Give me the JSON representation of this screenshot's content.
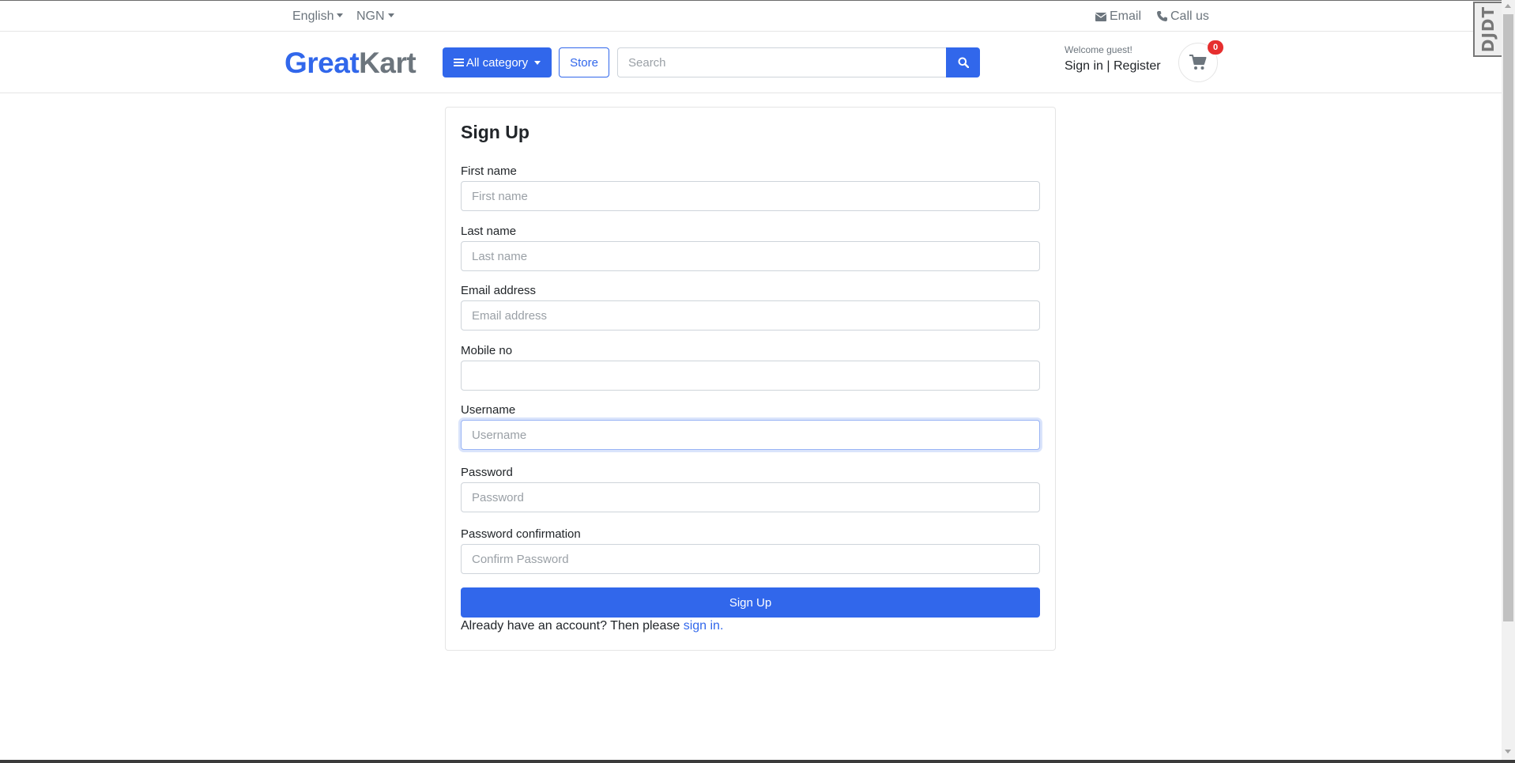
{
  "topbar": {
    "language": "English",
    "currency": "NGN",
    "email_label": "Email",
    "call_label": "Call us"
  },
  "header": {
    "logo_part1": "Great",
    "logo_part2": "Kart",
    "category_label": "All category",
    "store_label": "Store",
    "search_placeholder": "Search",
    "welcome": "Welcome guest!",
    "signin_label": "Sign in",
    "separator": "|",
    "register_label": "Register",
    "cart_count": "0"
  },
  "form": {
    "title": "Sign Up",
    "fields": [
      {
        "label": "First name",
        "placeholder": "First name",
        "value": ""
      },
      {
        "label": "Last name",
        "placeholder": "Last name",
        "value": ""
      },
      {
        "label": "Email address",
        "placeholder": "Email address",
        "value": ""
      },
      {
        "label": "Mobile no",
        "placeholder": "",
        "value": ""
      },
      {
        "label": "Username",
        "placeholder": "Username",
        "value": ""
      },
      {
        "label": "Password",
        "placeholder": "Password",
        "value": ""
      },
      {
        "label": "Password confirmation",
        "placeholder": "Confirm Password",
        "value": ""
      }
    ],
    "submit_label": "Sign Up",
    "footer_text": "Already have an account? Then please ",
    "footer_link": "sign in."
  },
  "debug_toolbar": {
    "label": "DJDT"
  },
  "colors": {
    "primary": "#3167eb",
    "muted": "#6c757d",
    "badge": "#e62e2e"
  }
}
